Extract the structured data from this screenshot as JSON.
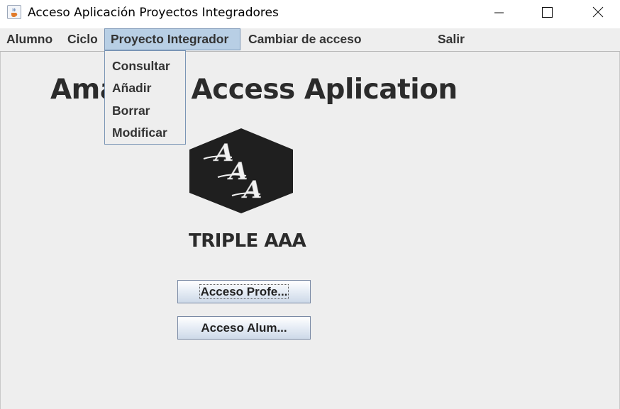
{
  "window": {
    "title": "Acceso Aplicación Proyectos Integradores",
    "icon": "java-coffee-icon",
    "controls": [
      "minimize-icon",
      "maximize-icon",
      "close-icon"
    ]
  },
  "menubar": {
    "items": [
      {
        "label": "Alumno"
      },
      {
        "label": "Ciclo"
      },
      {
        "label": "Proyecto Integrador",
        "active": true
      },
      {
        "label": "Cambiar de acceso"
      },
      {
        "label": "Salir"
      }
    ]
  },
  "dropdown": {
    "items": [
      {
        "label": "Consultar"
      },
      {
        "label": "Añadir"
      },
      {
        "label": "Borrar"
      },
      {
        "label": "Modificar"
      }
    ]
  },
  "main": {
    "heading": "Amazing Access Aplication",
    "logo": {
      "letters": [
        "A",
        "A",
        "A"
      ]
    },
    "brand": "TRIPLE AAA",
    "buttons": {
      "profesor": "Acceso Profe...",
      "alumno": "Acceso Alum..."
    }
  },
  "colors": {
    "menu_bg": "#eeeeee",
    "menu_active_bg": "#b8cfe5",
    "text": "#333333",
    "logo_bg": "#1f1f1f"
  }
}
